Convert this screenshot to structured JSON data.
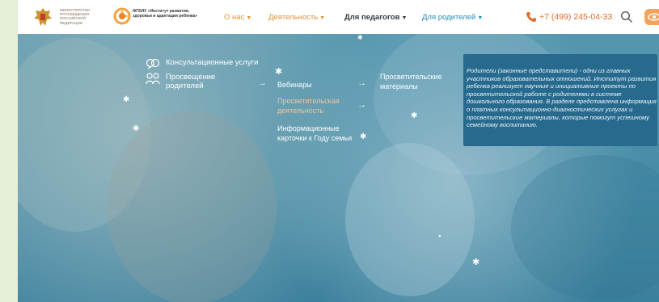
{
  "header": {
    "ministry_text": "МИНИСТЕРСТВО ПРОСВЕЩЕНИЯ РОССИЙСКОЙ ФЕДЕРАЦИИ",
    "institute_text": "ФГБНУ «Институт развития, здоровья и адаптации ребенка»",
    "nav": [
      {
        "label": "О нас",
        "has_dropdown": true
      },
      {
        "label": "Деятельность",
        "has_dropdown": true
      },
      {
        "label": "Для педагогов",
        "has_dropdown": true
      },
      {
        "label": "Для родителей",
        "has_dropdown": true
      }
    ],
    "phone": "+7 (499) 245-04-33",
    "icons": [
      "phone-icon",
      "search-icon",
      "eye-icon"
    ],
    "colors": {
      "accent_orange": "#e6902f",
      "phone_red": "#e06a2e",
      "nav_blue": "#1f8fbf"
    }
  },
  "menu": {
    "level1": [
      {
        "label": "Консультационные услуги",
        "icon": "consult-icon"
      },
      {
        "label": "Просвещение родителей",
        "icon": "education-icon",
        "active": true
      }
    ],
    "level2": [
      {
        "label": "Вебинары"
      },
      {
        "label": "Просветительская деятельность",
        "highlight": true
      },
      {
        "label": "Информационные карточки к Году семьи"
      }
    ],
    "level3": [
      {
        "label": "Просветительские материалы"
      }
    ]
  },
  "info": {
    "text": "Родители (законные представители) - одни из главных участников образовательных отношений. Институт развития ребенка реализует научные и инициативные проекты по просветительской работе с родителями в системе дошкольного образования. В разделе представлена информация о платных консультационно-диагностических услугах и просветительские материалы, которые помогут успешному семейному воспитанию.",
    "background": "#276a8e"
  }
}
